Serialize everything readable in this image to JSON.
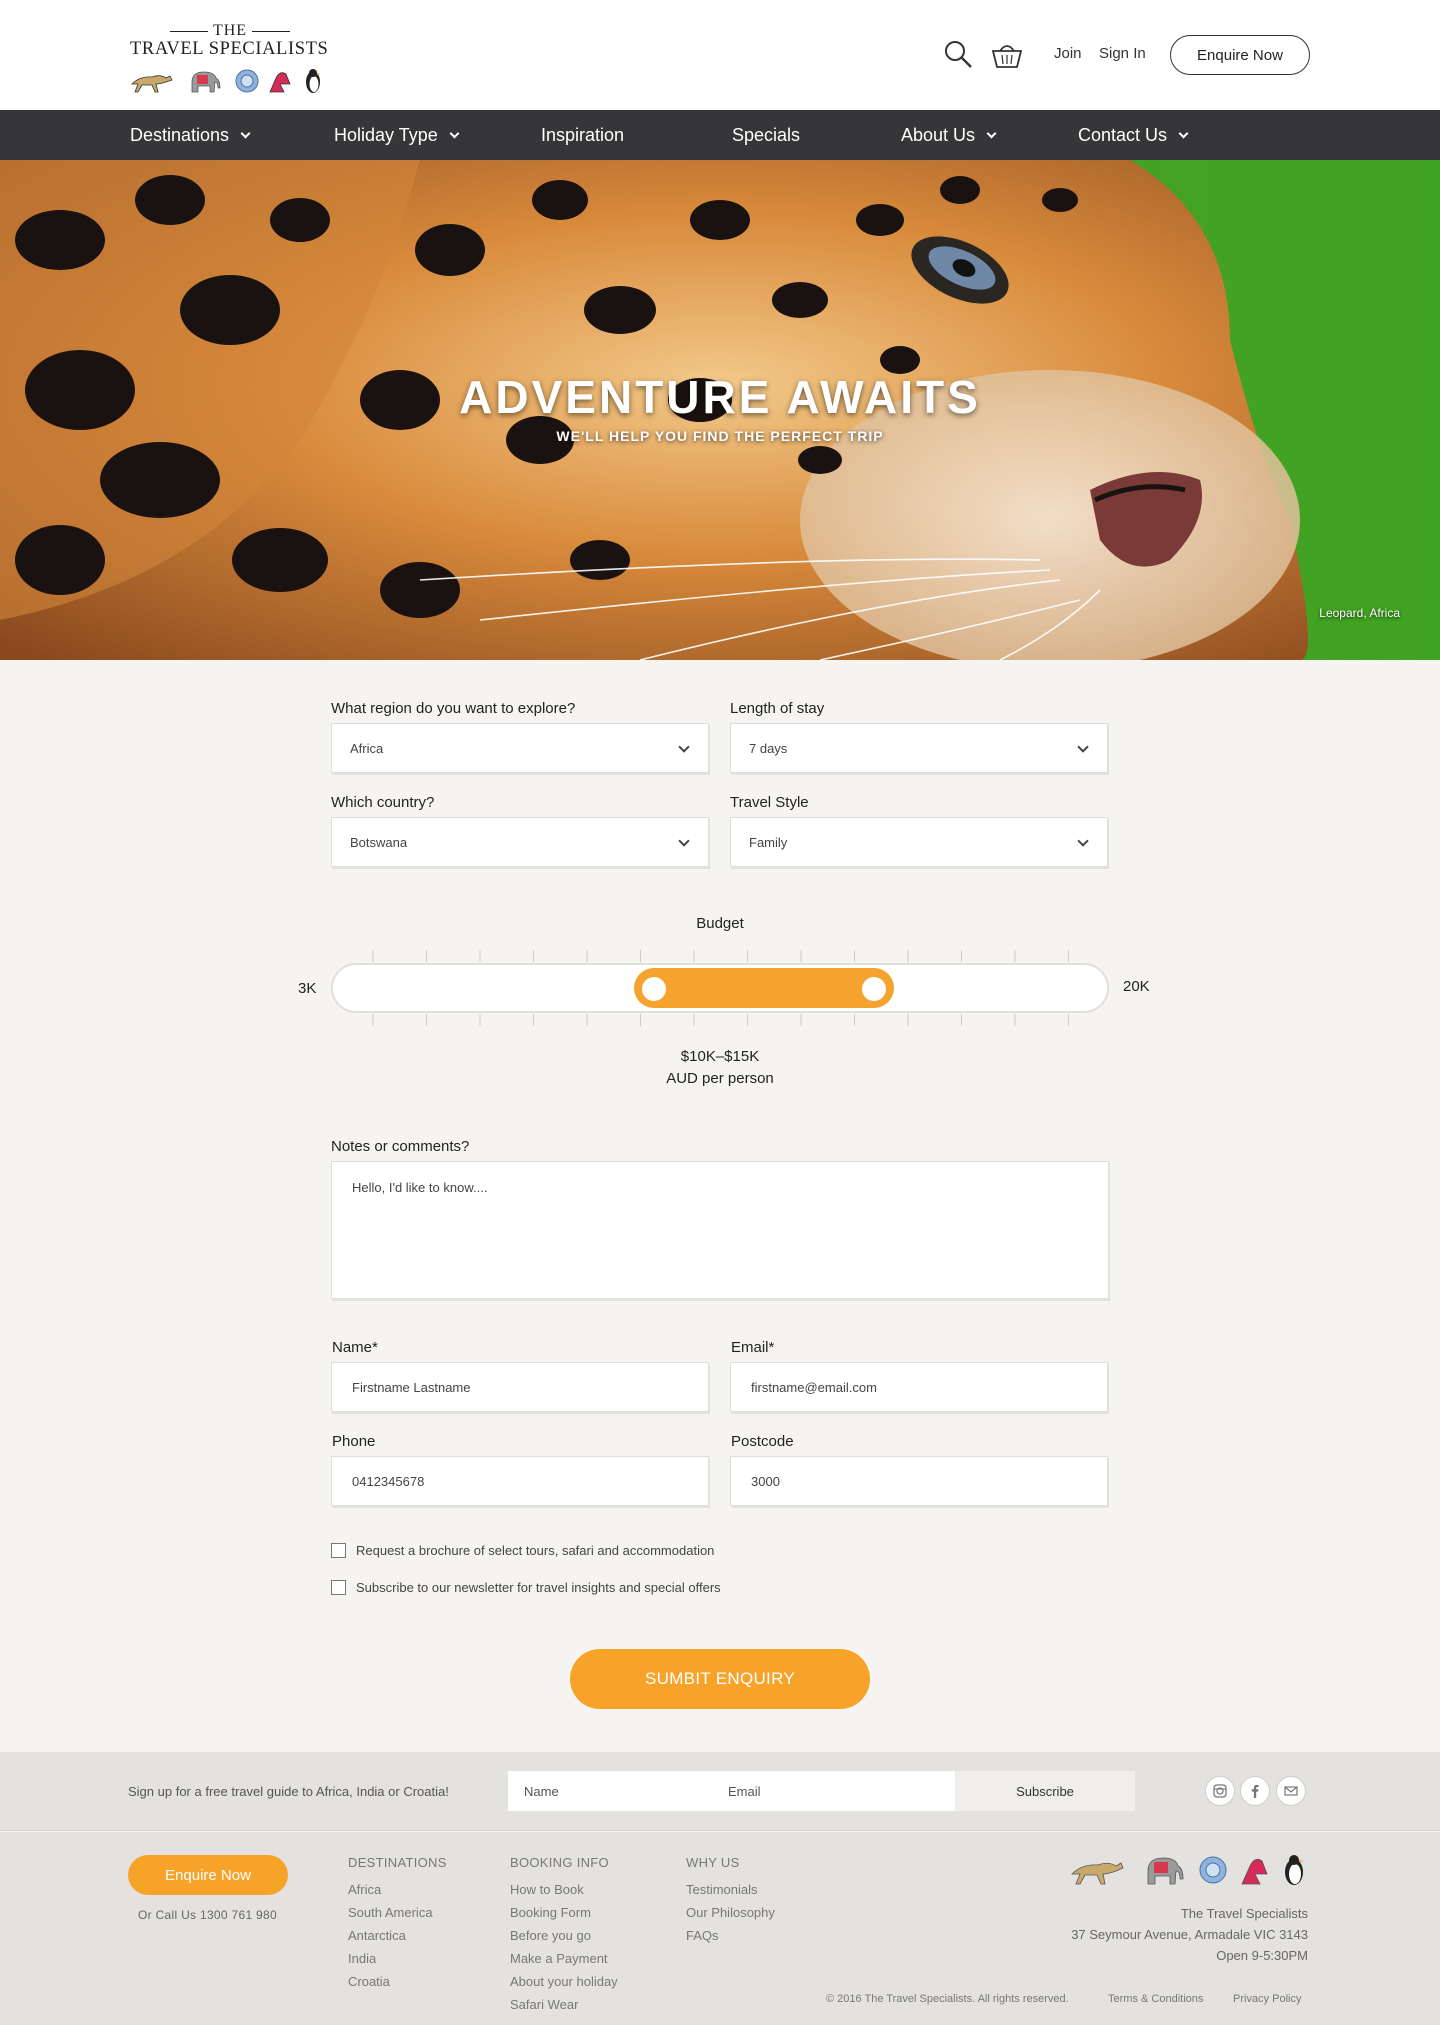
{
  "header": {
    "logo_the": "THE",
    "logo_name": "TRAVEL SPECIALISTS",
    "join": "Join",
    "sign_in": "Sign In",
    "enquire": "Enquire Now"
  },
  "nav": {
    "items": [
      {
        "label": "Destinations",
        "dropdown": true
      },
      {
        "label": "Holiday Type",
        "dropdown": true
      },
      {
        "label": "Inspiration",
        "dropdown": false
      },
      {
        "label": "Specials",
        "dropdown": false
      },
      {
        "label": "About Us",
        "dropdown": true
      },
      {
        "label": "Contact Us",
        "dropdown": true
      }
    ]
  },
  "hero": {
    "title": "ADVENTURE AWAITS",
    "subtitle": "WE'LL HELP YOU FIND THE PERFECT TRIP",
    "caption": "Leopard, Africa"
  },
  "form": {
    "region": {
      "label": "What region do you want to explore?",
      "value": "Africa"
    },
    "length": {
      "label": "Length of stay",
      "value": "7 days"
    },
    "country": {
      "label": "Which country?",
      "value": "Botswana"
    },
    "style": {
      "label": "Travel Style",
      "value": "Family"
    },
    "budget": {
      "label": "Budget",
      "min_label": "3K",
      "max_label": "20K",
      "min": 3,
      "max": 20,
      "low": 10,
      "high": 15,
      "range_text": "$10K–$15K",
      "unit_text": "AUD per person"
    },
    "notes": {
      "label": "Notes or comments?",
      "placeholder": "Hello, I'd like to know...."
    },
    "name": {
      "label": "Name*",
      "placeholder": "Firstname Lastname"
    },
    "email": {
      "label": "Email*",
      "placeholder": "firstname@email.com"
    },
    "phone": {
      "label": "Phone",
      "placeholder": "0412345678"
    },
    "postcode": {
      "label": "Postcode",
      "placeholder": "3000"
    },
    "checkbox_brochure": "Request a brochure of select tours, safari and accommodation",
    "checkbox_newsletter": "Subscribe to our newsletter for travel insights and special offers",
    "submit": "SUMBIT ENQUIRY"
  },
  "signup": {
    "text": "Sign up for a free travel guide to Africa, India or Croatia!",
    "name_placeholder": "Name",
    "email_placeholder": "Email",
    "subscribe": "Subscribe",
    "social": [
      "instagram-icon",
      "facebook-icon",
      "mail-icon"
    ]
  },
  "footer": {
    "enquire": "Enquire Now",
    "call": "Or Call Us 1300 761 980",
    "columns": [
      {
        "heading": "DESTINATIONS",
        "links": [
          "Africa",
          "South America",
          "Antarctica",
          "India",
          "Croatia"
        ]
      },
      {
        "heading": "BOOKING INFO",
        "links": [
          "How to Book",
          "Booking Form",
          "Before you go",
          "Make a Payment",
          "About your holiday",
          "Safari Wear"
        ]
      },
      {
        "heading": "WHY US",
        "links": [
          "Testimonials",
          "Our Philosophy",
          "FAQs"
        ]
      }
    ],
    "company": "The Travel Specialists",
    "address": "37 Seymour Avenue, Armadale VIC 3143",
    "hours": "Open 9-5:30PM",
    "copyright": "© 2016 The Travel Specialists. All rights reserved.",
    "terms": "Terms & Conditions",
    "privacy": "Privacy Policy"
  },
  "colors": {
    "accent": "#f7a32a",
    "nav_bg": "#363538",
    "page_bg": "#f5f4f1",
    "footer_bg": "#e4e2df"
  }
}
